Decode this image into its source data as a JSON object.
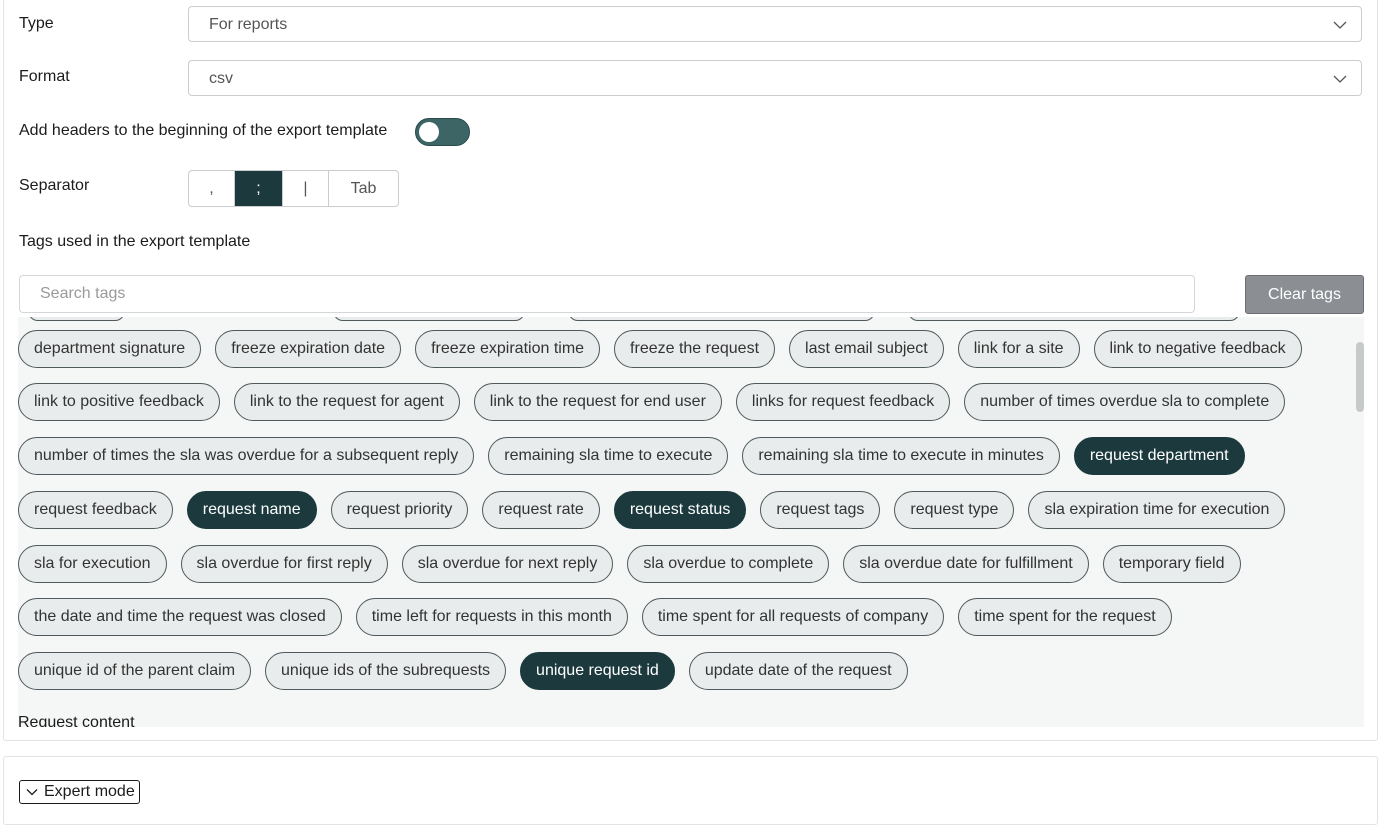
{
  "form": {
    "type_label": "Type",
    "type_value": "For reports",
    "format_label": "Format",
    "format_value": "csv",
    "headers_label": "Add headers to the beginning of the export template",
    "headers_enabled": false,
    "separator_label": "Separator",
    "separator_options": [
      ",",
      ";",
      "|",
      "Tab"
    ],
    "separator_selected": ";",
    "tags_label": "Tags used in the export template",
    "search_placeholder": "Search tags",
    "clear_label": "Clear tags"
  },
  "tags": {
    "rows": [
      [
        {
          "label": "department signature",
          "selected": false
        },
        {
          "label": "freeze expiration date",
          "selected": false
        },
        {
          "label": "freeze expiration time",
          "selected": false
        },
        {
          "label": "freeze the request",
          "selected": false
        },
        {
          "label": "last email subject",
          "selected": false
        },
        {
          "label": "link for a site",
          "selected": false
        },
        {
          "label": "link to negative feedback",
          "selected": false
        }
      ],
      [
        {
          "label": "link to positive feedback",
          "selected": false
        },
        {
          "label": "link to the request for agent",
          "selected": false
        },
        {
          "label": "link to the request for end user",
          "selected": false
        },
        {
          "label": "links for request feedback",
          "selected": false
        },
        {
          "label": "number of times overdue sla to complete",
          "selected": false
        }
      ],
      [
        {
          "label": "number of times the sla was overdue for a subsequent reply",
          "selected": false
        },
        {
          "label": "remaining sla time to execute",
          "selected": false
        },
        {
          "label": "remaining sla time to execute in minutes",
          "selected": false
        },
        {
          "label": "request department",
          "selected": true
        }
      ],
      [
        {
          "label": "request feedback",
          "selected": false
        },
        {
          "label": "request name",
          "selected": true
        },
        {
          "label": "request priority",
          "selected": false
        },
        {
          "label": "request rate",
          "selected": false
        },
        {
          "label": "request status",
          "selected": true
        },
        {
          "label": "request tags",
          "selected": false
        },
        {
          "label": "request type",
          "selected": false
        },
        {
          "label": "sla expiration time for execution",
          "selected": false
        }
      ],
      [
        {
          "label": "sla for execution",
          "selected": false
        },
        {
          "label": "sla overdue for first reply",
          "selected": false
        },
        {
          "label": "sla overdue for next reply",
          "selected": false
        },
        {
          "label": "sla overdue to complete",
          "selected": false
        },
        {
          "label": "sla overdue date for fulfillment",
          "selected": false
        },
        {
          "label": "temporary field",
          "selected": false
        }
      ],
      [
        {
          "label": "the date and time the request was closed",
          "selected": false
        },
        {
          "label": "time left for requests in this month",
          "selected": false
        },
        {
          "label": "time spent for all requests of company",
          "selected": false
        },
        {
          "label": "time spent for the request",
          "selected": false
        }
      ],
      [
        {
          "label": "unique id of the parent claim",
          "selected": false
        },
        {
          "label": "unique ids of the subrequests",
          "selected": false
        },
        {
          "label": "unique request id",
          "selected": true
        },
        {
          "label": "update date of the request",
          "selected": false
        }
      ]
    ],
    "next_section_label": "Request content"
  },
  "expert": {
    "label": "Expert mode"
  },
  "colors": {
    "accent": "#1c3a3e",
    "toggle": "#3e6565",
    "clear_button": "#8b8f94"
  }
}
